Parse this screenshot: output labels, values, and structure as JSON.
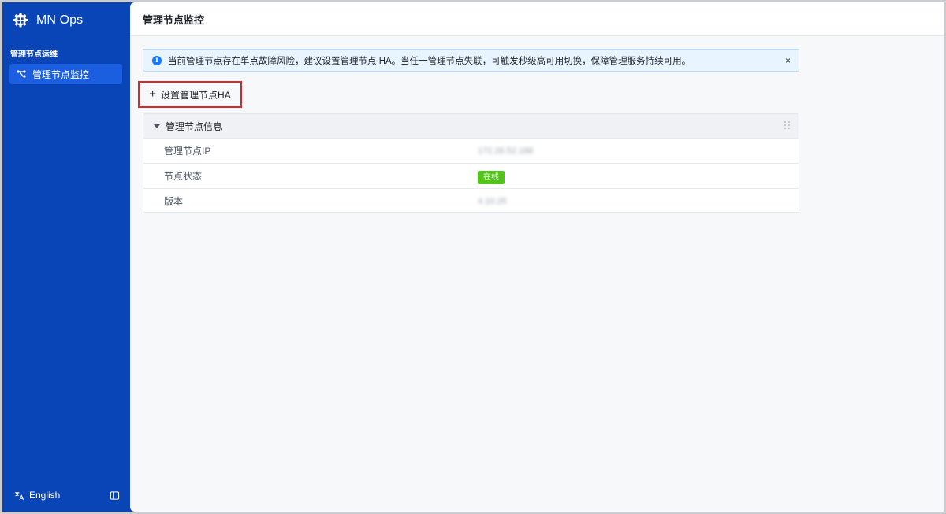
{
  "app": {
    "name": "MN Ops"
  },
  "sidebar": {
    "group_title": "管理节点运维",
    "items": [
      {
        "label": "管理节点监控",
        "icon": "topology-icon"
      }
    ],
    "footer": {
      "language": "English"
    }
  },
  "page": {
    "title": "管理节点监控"
  },
  "alert": {
    "text": "当前管理节点存在单点故障风险，建议设置管理节点 HA。当任一管理节点失联，可触发秒级高可用切换，保障管理服务持续可用。",
    "close": "×"
  },
  "actions": {
    "setup_ha": "设置管理节点HA"
  },
  "panel": {
    "title": "管理节点信息",
    "rows": [
      {
        "label": "管理节点IP",
        "value": "172.26.52.188"
      },
      {
        "label": "节点状态",
        "value": "在线"
      },
      {
        "label": "版本",
        "value": "4.10.25"
      }
    ]
  },
  "colors": {
    "sidebar_bg": "#0a45b7",
    "active_nav": "#1b5ee0",
    "status_online": "#52c41a",
    "highlight_border": "#d9262c"
  }
}
